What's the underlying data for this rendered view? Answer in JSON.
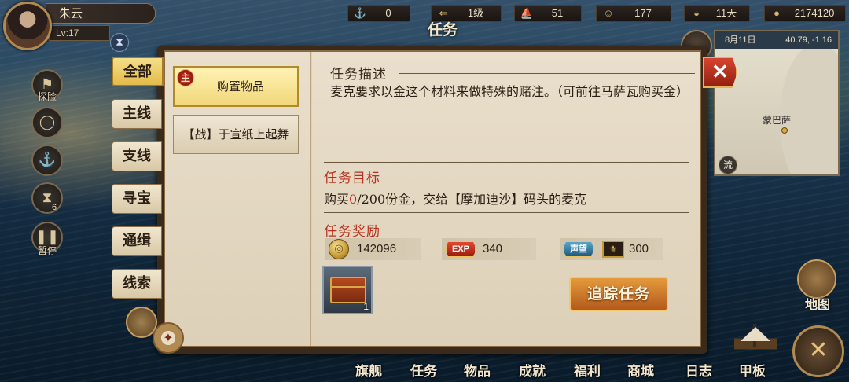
{
  "player": {
    "name": "朱云",
    "level": "Lv:17"
  },
  "stats": [
    {
      "icon": "anchor-hook-icon",
      "glyph": "⚓",
      "value": "0"
    },
    {
      "icon": "rank-arrow-icon",
      "glyph": "⇐",
      "value": "1级"
    },
    {
      "icon": "ship-icon",
      "glyph": "⛵",
      "value": "51"
    },
    {
      "icon": "sailor-icon",
      "glyph": "☺",
      "value": "177"
    },
    {
      "icon": "bread-icon",
      "glyph": "◒",
      "value": "11天"
    },
    {
      "icon": "gold-coin-icon",
      "glyph": "●",
      "value": "2174120"
    }
  ],
  "left_menu": {
    "explore_label": "探险",
    "pause_label": "暂停",
    "hourglass_badge": "6"
  },
  "window": {
    "title": "任务",
    "close_glyph": "✕"
  },
  "tabs": [
    {
      "label": "全部",
      "active": true
    },
    {
      "label": "主线",
      "active": false
    },
    {
      "label": "支线",
      "active": false
    },
    {
      "label": "寻宝",
      "active": false
    },
    {
      "label": "通缉",
      "active": false
    },
    {
      "label": "线索",
      "active": false
    }
  ],
  "quests": [
    {
      "badge": "主",
      "title": "购置物品",
      "selected": true
    },
    {
      "title": "【战】于宣纸上起舞",
      "selected": false
    }
  ],
  "detail": {
    "desc_header": "任务描述",
    "description": "麦克要求以金这个材料来做特殊的赌注。（可前往马萨瓦购买金）",
    "goal_header": "任务目标",
    "goal_prefix": "购买",
    "goal_current": "0",
    "goal_suffix": "/200份金，交给【摩加迪沙】码头的麦克",
    "reward_header": "任务奖励",
    "rewards": {
      "gold": "142096",
      "exp_badge": "EXP",
      "exp": "340",
      "reputation_badge": "声望",
      "reputation": "300",
      "item_count": "1"
    },
    "track_button": "追踪任务"
  },
  "minimap": {
    "date": "8月11日",
    "coords": "40.79, -1.16",
    "place": "蒙巴萨",
    "flow_label": "流"
  },
  "right_buttons": {
    "map_label": "地图"
  },
  "bottom_menu": [
    "旗舰",
    "任务",
    "物品",
    "成就",
    "福利",
    "商城",
    "日志",
    "甲板"
  ],
  "colors": {
    "accent_gold": "#e3bb48",
    "highlight_red": "#d1221a",
    "header_red": "#b8321e",
    "header_dark": "#3a2a1c"
  }
}
